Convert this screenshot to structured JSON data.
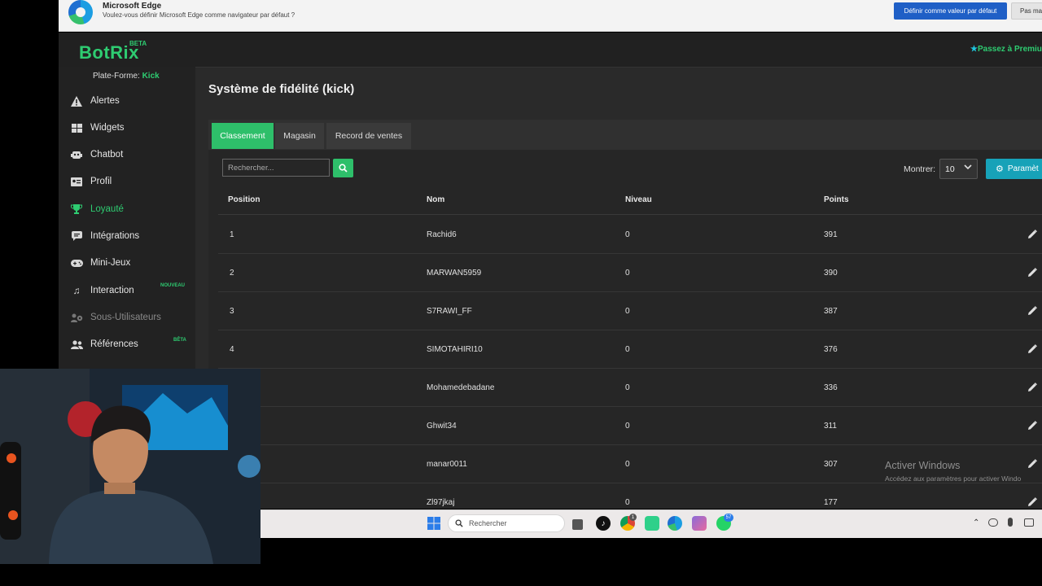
{
  "browser_banner": {
    "title": "Microsoft Edge",
    "message": "Voulez-vous définir Microsoft Edge comme navigateur par défaut ?",
    "set_default_label": "Définir comme valeur par défaut",
    "not_now_label": "Pas mai"
  },
  "app": {
    "logo": "BotRix",
    "logo_badge": "BETA",
    "premium_label": "Passez à Premiu"
  },
  "sidebar": {
    "platform_label": "Plate-Forme:",
    "platform_value": "Kick",
    "items": [
      {
        "label": "Alertes",
        "icon": "warning-icon"
      },
      {
        "label": "Widgets",
        "icon": "grid-icon"
      },
      {
        "label": "Chatbot",
        "icon": "robot-icon"
      },
      {
        "label": "Profil",
        "icon": "id-card-icon"
      },
      {
        "label": "Loyauté",
        "icon": "trophy-icon",
        "active": true
      },
      {
        "label": "Intégrations",
        "icon": "chat-icon"
      },
      {
        "label": "Mini-Jeux",
        "icon": "gamepad-icon"
      },
      {
        "label": "Interaction",
        "icon": "music-icon",
        "badge": "NOUVEAU"
      },
      {
        "label": "Sous-Utilisateurs",
        "icon": "users-cog-icon",
        "disabled": true
      },
      {
        "label": "Références",
        "icon": "users-icon",
        "badge": "BÊTA"
      }
    ]
  },
  "main": {
    "title": "Système de fidélité (kick)",
    "tabs": [
      {
        "label": "Classement",
        "active": true
      },
      {
        "label": "Magasin"
      },
      {
        "label": "Record de ventes"
      }
    ],
    "search_placeholder": "Rechercher...",
    "show_label": "Montrer:",
    "show_value": "10",
    "params_label": "Paramèt"
  },
  "table": {
    "columns": [
      "Position",
      "Nom",
      "Niveau",
      "Points"
    ],
    "rows": [
      {
        "position": "1",
        "name": "Rachid6",
        "level": "0",
        "points": "391"
      },
      {
        "position": "2",
        "name": "MARWAN5959",
        "level": "0",
        "points": "390"
      },
      {
        "position": "3",
        "name": "S7RAWI_FF",
        "level": "0",
        "points": "387"
      },
      {
        "position": "4",
        "name": "SIMOTAHIRI10",
        "level": "0",
        "points": "376"
      },
      {
        "position": "",
        "name": "Mohamedebadane",
        "level": "0",
        "points": "336"
      },
      {
        "position": "",
        "name": "Ghwit34",
        "level": "0",
        "points": "311"
      },
      {
        "position": "",
        "name": "manar0011",
        "level": "0",
        "points": "307"
      },
      {
        "position": "",
        "name": "Zl97jkaj",
        "level": "0",
        "points": "177"
      }
    ]
  },
  "windows_watermark": {
    "title": "Activer Windows",
    "subtitle": "Accédez aux paramètres pour activer Windo"
  },
  "taskbar": {
    "search_label": "Rechercher",
    "chrome_badge": "1",
    "whatsapp_badge": "57"
  },
  "colors": {
    "accent": "#2ebf6a",
    "info": "#17a2b8",
    "edge_blue": "#1f5fc6"
  }
}
